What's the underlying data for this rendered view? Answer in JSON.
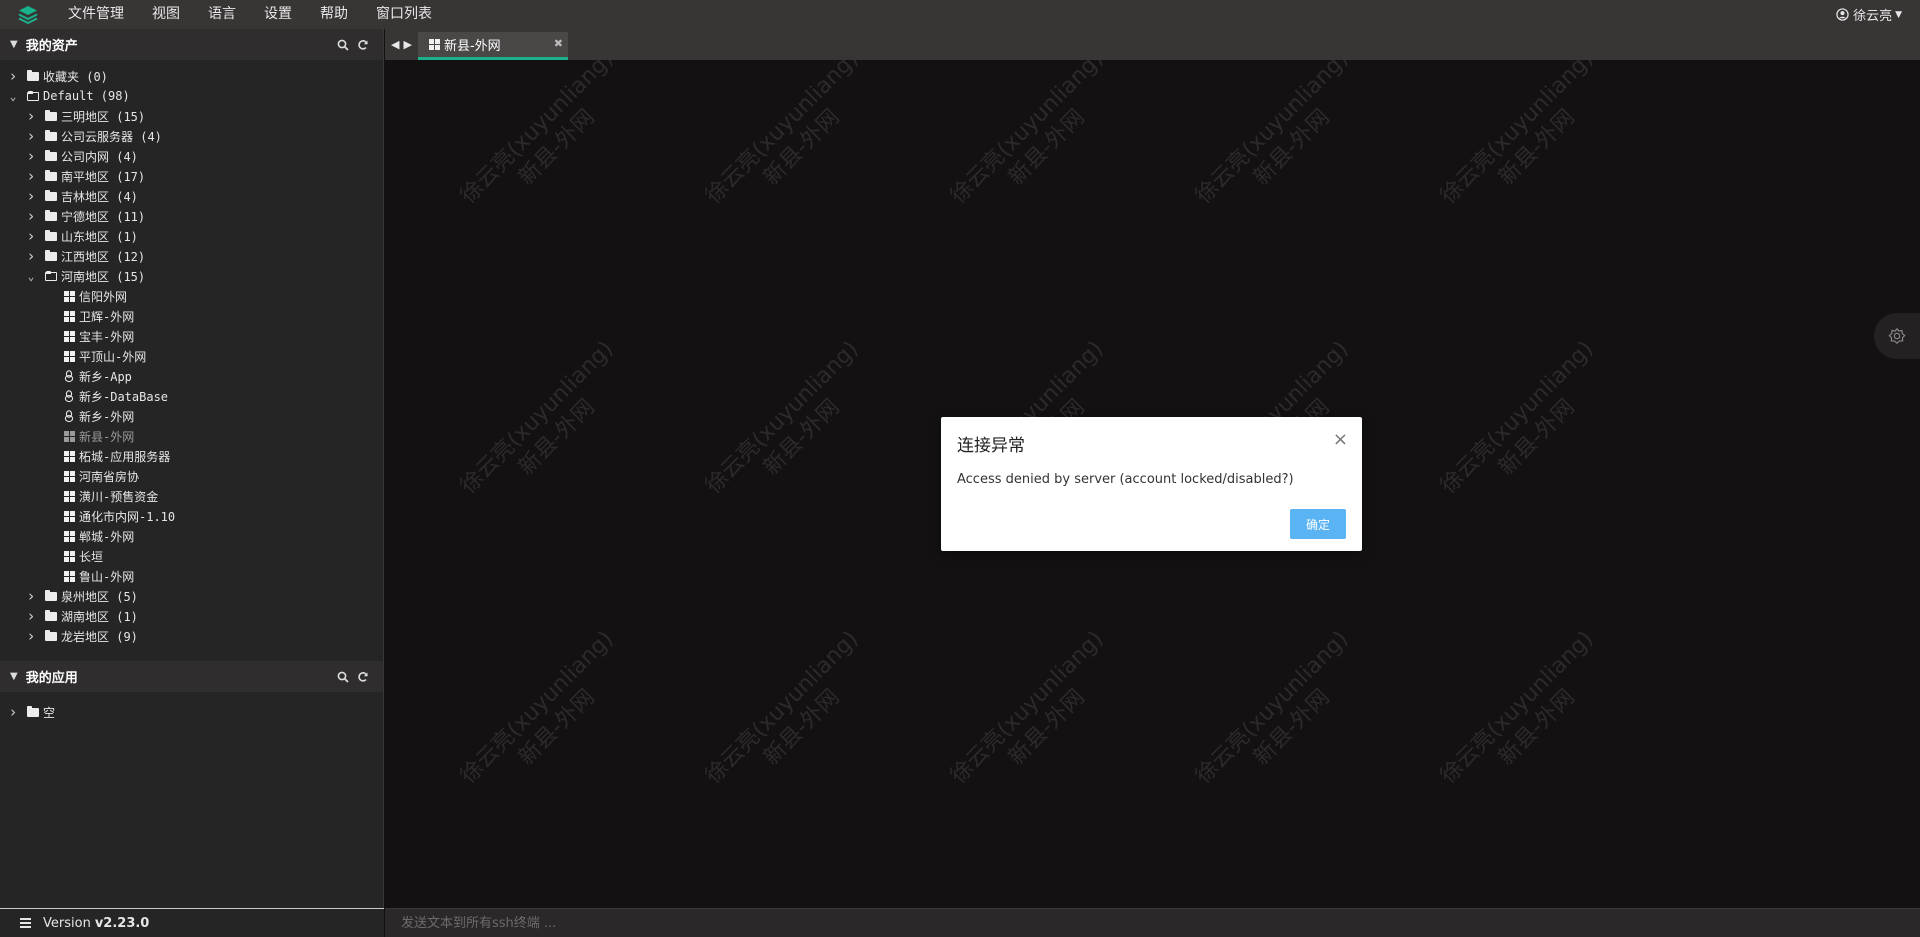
{
  "menubar": {
    "items": [
      "文件管理",
      "视图",
      "语言",
      "设置",
      "帮助",
      "窗口列表"
    ],
    "user": "徐云亮"
  },
  "assets_panel": {
    "title": "我的资产",
    "tree": [
      {
        "label": "收藏夹 (0)",
        "level": 0,
        "type": "folder",
        "expanded": false
      },
      {
        "label": "Default (98)",
        "level": 0,
        "type": "folder",
        "expanded": true
      },
      {
        "label": "三明地区 (15)",
        "level": 1,
        "type": "folder",
        "expanded": false
      },
      {
        "label": "公司云服务器 (4)",
        "level": 1,
        "type": "folder",
        "expanded": false
      },
      {
        "label": "公司内网 (4)",
        "level": 1,
        "type": "folder",
        "expanded": false
      },
      {
        "label": "南平地区 (17)",
        "level": 1,
        "type": "folder",
        "expanded": false
      },
      {
        "label": "吉林地区 (4)",
        "level": 1,
        "type": "folder",
        "expanded": false
      },
      {
        "label": "宁德地区 (11)",
        "level": 1,
        "type": "folder",
        "expanded": false
      },
      {
        "label": "山东地区 (1)",
        "level": 1,
        "type": "folder",
        "expanded": false
      },
      {
        "label": "江西地区 (12)",
        "level": 1,
        "type": "folder",
        "expanded": false
      },
      {
        "label": "河南地区 (15)",
        "level": 1,
        "type": "folder",
        "expanded": true
      },
      {
        "label": "信阳外网",
        "level": 2,
        "type": "windows"
      },
      {
        "label": "卫辉-外网",
        "level": 2,
        "type": "windows"
      },
      {
        "label": "宝丰-外网",
        "level": 2,
        "type": "windows"
      },
      {
        "label": "平顶山-外网",
        "level": 2,
        "type": "windows"
      },
      {
        "label": "新乡-App",
        "level": 2,
        "type": "linux"
      },
      {
        "label": "新乡-DataBase",
        "level": 2,
        "type": "linux"
      },
      {
        "label": "新乡-外网",
        "level": 2,
        "type": "linux"
      },
      {
        "label": "新县-外网",
        "level": 2,
        "type": "windows",
        "dim": true
      },
      {
        "label": "柘城-应用服务器",
        "level": 2,
        "type": "windows"
      },
      {
        "label": "河南省房协",
        "level": 2,
        "type": "windows"
      },
      {
        "label": "潢川-预售资金",
        "level": 2,
        "type": "windows"
      },
      {
        "label": "通化市内网-1.10",
        "level": 2,
        "type": "windows"
      },
      {
        "label": "郸城-外网",
        "level": 2,
        "type": "windows"
      },
      {
        "label": "长垣",
        "level": 2,
        "type": "windows"
      },
      {
        "label": "鲁山-外网",
        "level": 2,
        "type": "windows"
      },
      {
        "label": "泉州地区 (5)",
        "level": 1,
        "type": "folder",
        "expanded": false
      },
      {
        "label": "湖南地区 (1)",
        "level": 1,
        "type": "folder",
        "expanded": false
      },
      {
        "label": "龙岩地区 (9)",
        "level": 1,
        "type": "folder",
        "expanded": false
      }
    ]
  },
  "apps_panel": {
    "title": "我的应用",
    "tree": [
      {
        "label": "空",
        "level": 0,
        "type": "folder",
        "expanded": false
      }
    ]
  },
  "footer": {
    "version_label": "Version",
    "version": "v2.23.0"
  },
  "tabs": [
    {
      "label": "新县-外网",
      "active": true
    }
  ],
  "terminal": {
    "watermark_line1": "徐云亮(xuyunliang)",
    "watermark_line2": "新县-外网"
  },
  "broadcast": {
    "placeholder": "发送文本到所有ssh终端 ..."
  },
  "modal": {
    "title": "连接异常",
    "message": "Access denied by server (account locked/disabled?)",
    "ok_label": "确定"
  },
  "colors": {
    "accent": "#19b28d",
    "button": "#5ab3f2",
    "terminal_bg": "#131112"
  }
}
